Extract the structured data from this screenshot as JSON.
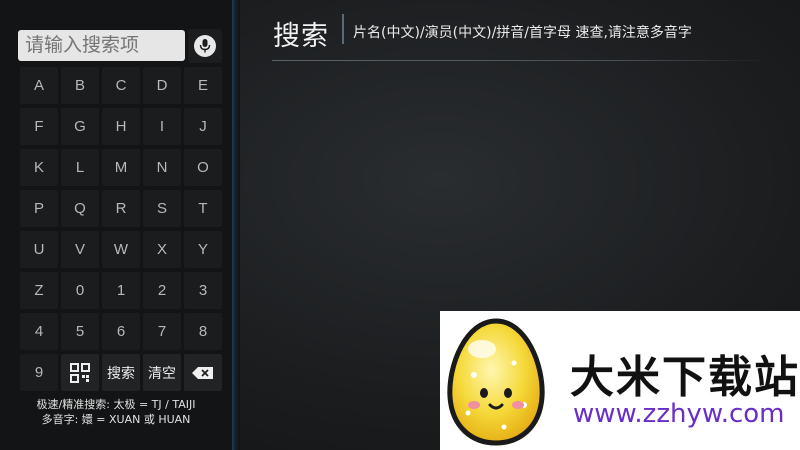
{
  "search": {
    "placeholder": "请输入搜索项"
  },
  "keyboard": {
    "rows": [
      [
        "A",
        "B",
        "C",
        "D",
        "E"
      ],
      [
        "F",
        "G",
        "H",
        "I",
        "J"
      ],
      [
        "K",
        "L",
        "M",
        "N",
        "O"
      ],
      [
        "P",
        "Q",
        "R",
        "S",
        "T"
      ],
      [
        "U",
        "V",
        "W",
        "X",
        "Y"
      ],
      [
        "Z",
        "0",
        "1",
        "2",
        "3"
      ],
      [
        "4",
        "5",
        "6",
        "7",
        "8"
      ]
    ],
    "last_row": {
      "key9": "9",
      "search_label": "搜索",
      "clear_label": "清空"
    }
  },
  "hints": {
    "line1": "极速/精准搜索: 太极 = TJ / TAIJI",
    "line2": "多音字: 嬛 = XUAN 或 HUAN"
  },
  "header": {
    "title": "搜索",
    "subtitle": "片名(中文)/演员(中文)/拼音/首字母 速查,请注意多音字"
  },
  "watermark": {
    "name": "大米下载站",
    "url": "www.zzhyw.com"
  },
  "icons": {
    "mic": "microphone-icon",
    "qr": "qr-code-icon",
    "backspace": "backspace-icon"
  },
  "colors": {
    "accent_divider": "#1e3f55",
    "watermark_url": "#6a2ec8"
  }
}
